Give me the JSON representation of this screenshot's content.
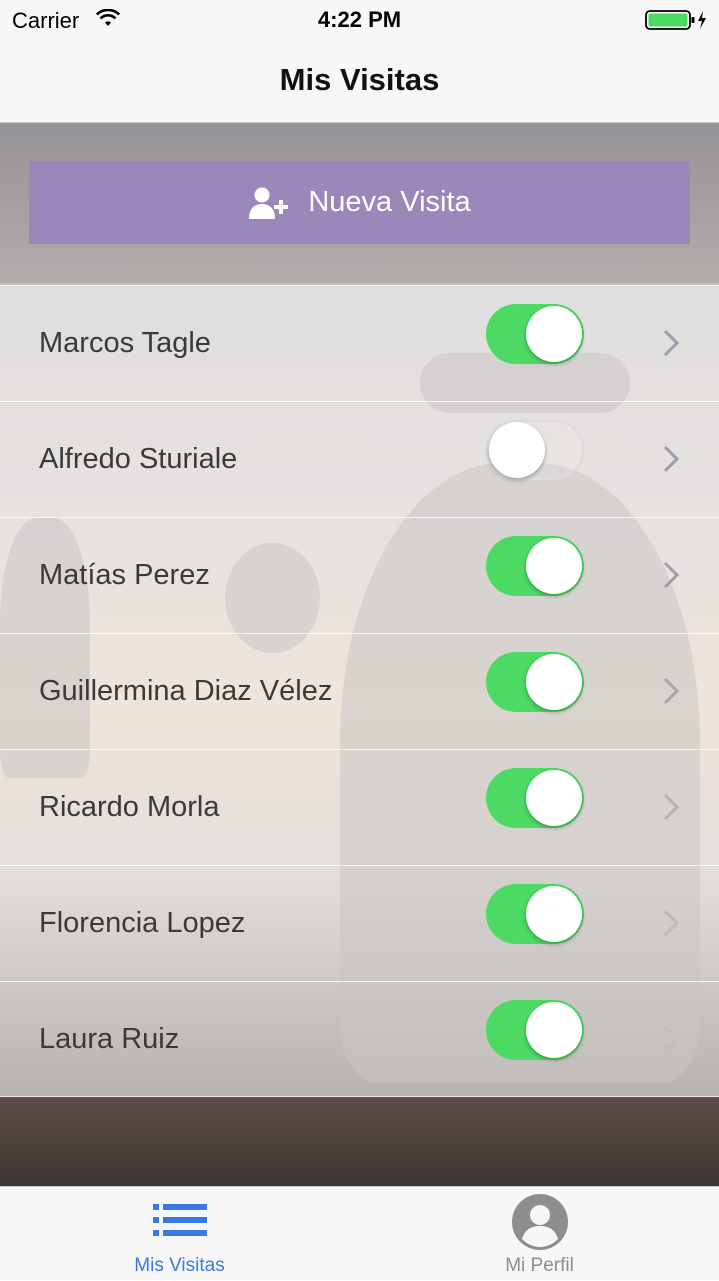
{
  "status_bar": {
    "carrier": "Carrier",
    "time": "4:22 PM",
    "wifi_icon": "wifi-icon",
    "battery_icon": "battery-charging-icon"
  },
  "nav": {
    "title": "Mis Visitas"
  },
  "new_visit_button": {
    "label": "Nueva Visita",
    "icon": "add-user-icon",
    "color": "#9b88bb"
  },
  "visits": [
    {
      "name": "Marcos Tagle",
      "enabled": true
    },
    {
      "name": "Alfredo Sturiale",
      "enabled": false
    },
    {
      "name": "Matías Perez",
      "enabled": true
    },
    {
      "name": "Guillermina Diaz Vélez",
      "enabled": true
    },
    {
      "name": "Ricardo Morla",
      "enabled": true
    },
    {
      "name": "Florencia Lopez",
      "enabled": true
    },
    {
      "name": "Laura Ruiz",
      "enabled": true
    }
  ],
  "tabbar": {
    "tabs": [
      {
        "label": "Mis Visitas",
        "icon": "list-icon",
        "active": true
      },
      {
        "label": "Mi Perfil",
        "icon": "profile-icon",
        "active": false
      }
    ]
  },
  "colors": {
    "toggle_on": "#4cd964",
    "tab_active": "#3a78e7",
    "tab_inactive": "#8e8e8e"
  }
}
